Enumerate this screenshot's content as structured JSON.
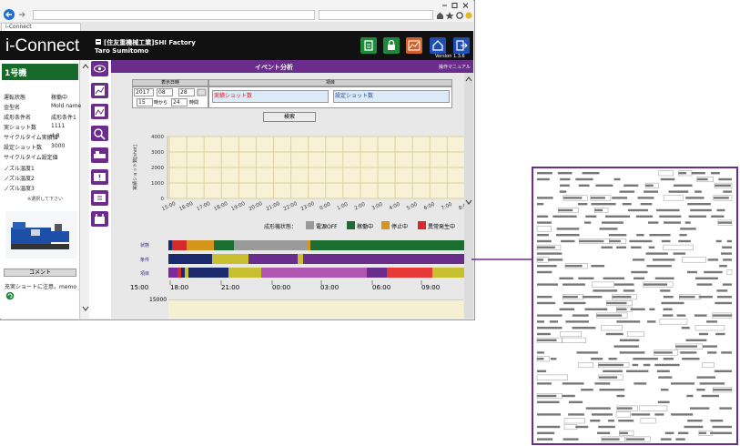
{
  "browser": {
    "tab_label": "i-Connect"
  },
  "header": {
    "logo": "i-Connect",
    "company": "[住友重機械工業]SHI Factory",
    "user": "Taro Sumitomo",
    "version": "Version 1.3.6"
  },
  "sidebar": {
    "machine_title": "1号機",
    "fields": [
      {
        "label": "運転状態",
        "value": "稼働中"
      },
      {
        "label": "金型名",
        "value": "Mold name"
      },
      {
        "label": "成形条件名",
        "value": "成形条件1"
      },
      {
        "label": "実ショット数",
        "value": "1111"
      },
      {
        "label": "サイクルタイム実績値",
        "value": "4.8"
      },
      {
        "label": "設定ショット数",
        "value": "3000"
      },
      {
        "label": "サイクルタイム設定値",
        "value": ""
      },
      {
        "label": "ノズル温度1",
        "value": ""
      },
      {
        "label": "ノズル温度2",
        "value": ""
      },
      {
        "label": "ノズル温度3",
        "value": ""
      }
    ],
    "select_note": "※選択して下さい",
    "comment_label": "コメント",
    "comment_text": "充実ショートに注意。memo"
  },
  "main": {
    "title": "イベント分析",
    "manual": "操作マニュアル",
    "datetime_header": "表示日時",
    "item_header": "項目",
    "year": "2017",
    "month": "08",
    "day": "28",
    "hour": "15",
    "hour_unit": "時から",
    "duration": "24",
    "duration_unit": "時間",
    "item1": "実績ショット数",
    "item2": "設定ショット数",
    "search_button": "検索",
    "legend_title": "成形機状態：",
    "legend": [
      {
        "label": "電源OFF",
        "color": "#9a9a9a"
      },
      {
        "label": "稼働中",
        "color": "#1a6e30"
      },
      {
        "label": "停止中",
        "color": "#d4961a"
      },
      {
        "label": "異常発生中",
        "color": "#d42a2a"
      }
    ],
    "row_labels": [
      "状態",
      "条件",
      "項目"
    ],
    "timeline_labels": [
      "15:00",
      "18:00",
      "21:00",
      "00:00",
      "03:00",
      "06:00",
      "09:00"
    ],
    "lower_y_label": "15000"
  },
  "chart_data": {
    "type": "line",
    "ylabel": "実績ショット数[shot]",
    "ylim": [
      0,
      4000
    ],
    "yticks": [
      "4000",
      "3000",
      "2000",
      "1000",
      "0"
    ],
    "xticks": [
      "15:00",
      "16:00",
      "17:00",
      "18:00",
      "19:00",
      "20:00",
      "21:00",
      "22:00",
      "23:00",
      "0:00",
      "1:00",
      "2:00",
      "3:00",
      "4:00",
      "5:00",
      "6:00",
      "7:00",
      "8:00"
    ],
    "series": []
  },
  "doc_preview": {
    "border_color": "#6b2d8c"
  }
}
